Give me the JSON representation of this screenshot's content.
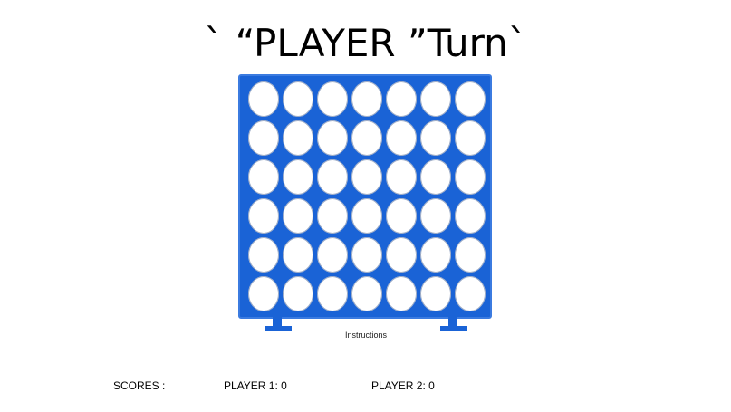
{
  "title": "` “PLAYER ”Turn`",
  "board": {
    "columns": 7,
    "rows": 6,
    "color": "#1a63d6",
    "slot_color": "#ffffff"
  },
  "instructions_label": "Instructions",
  "scores": {
    "label": "SCORES :",
    "player1": "PLAYER 1: 0",
    "player2": "PLAYER 2: 0"
  }
}
